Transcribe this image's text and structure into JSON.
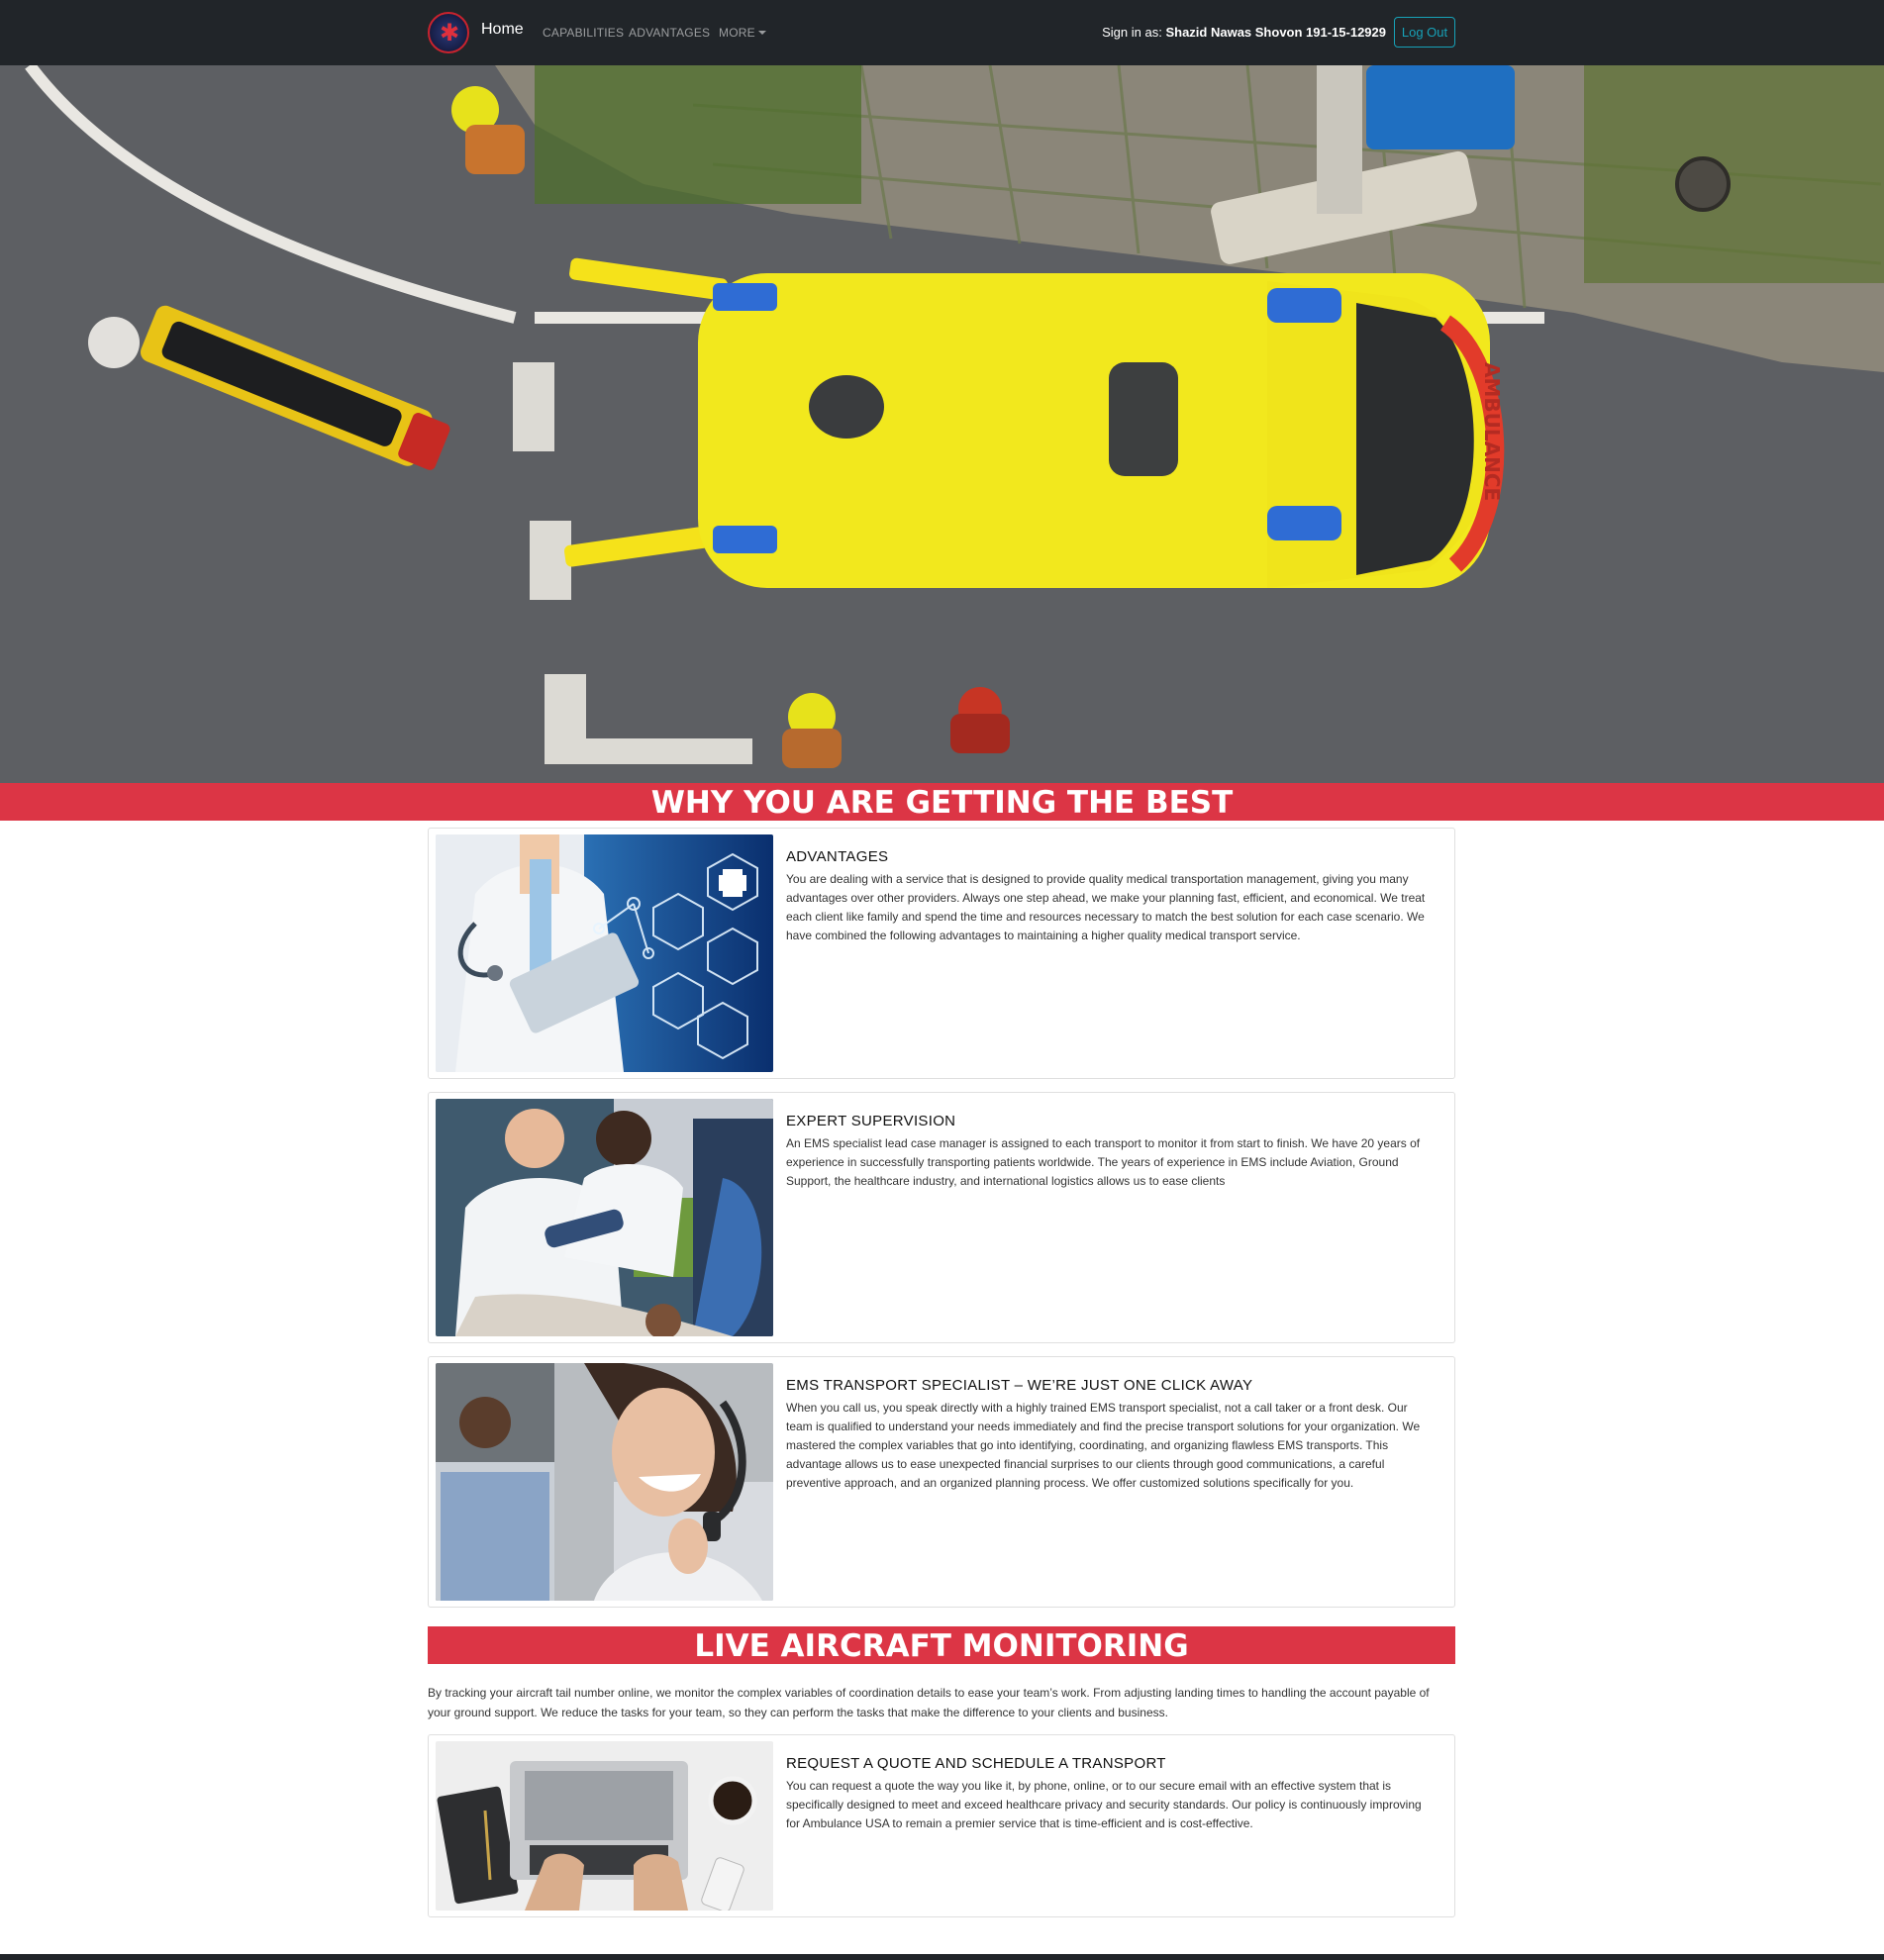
{
  "navbar": {
    "logo_icon": "star-of-life-logo",
    "home_label": "Home",
    "links": [
      "CAPABILITIES",
      "ADVANTAGES",
      "MORE"
    ],
    "signin_prefix": "Sign in as:",
    "user_name": "Shazid Nawas Shovon 191-15-12929",
    "logout_label": "Log Out"
  },
  "hero": {
    "image": "aerial-ambulance-photo",
    "vehicle_text": "AMBULANCE"
  },
  "why_banner": "WHY YOU ARE GETTING THE BEST",
  "cards": [
    {
      "image": "doctor-tablet-medical-icons-photo",
      "title": "ADVANTAGES",
      "text": "You are dealing with a service that is designed to provide quality medical transportation management, giving you many advantages over other providers. Always one step ahead, we make your planning fast, efficient, and economical. We treat each client like family and spend the time and resources necessary to match the best solution for each case scenario. We have combined the following advantages to maintaining a higher quality medical transport service."
    },
    {
      "image": "paramedics-patient-photo",
      "title": "EXPERT SUPERVISION",
      "text": "An EMS specialist lead case manager is assigned to each transport to monitor it from start to finish. We have 20 years of experience in successfully transporting patients worldwide. The years of experience in EMS include Aviation, Ground Support, the healthcare industry, and international logistics allows us to ease clients"
    },
    {
      "image": "call-center-agent-photo",
      "title": "EMS TRANSPORT SPECIALIST – WE’RE JUST ONE CLICK AWAY",
      "text": "When you call us, you speak directly with a highly trained EMS transport specialist, not a call taker or a front desk. Our team is qualified to understand your needs immediately and find the precise transport solutions for your organization. We mastered the complex variables that go into identifying, coordinating, and organizing flawless EMS transports. This advantage allows us to ease unexpected financial surprises to our clients through good communications, a careful preventive approach, and an organized planning process. We offer customized solutions specifically for you."
    }
  ],
  "monitoring": {
    "banner": "LIVE AIRCRAFT MONITORING",
    "paragraph": "By tracking your aircraft tail number online, we monitor the complex variables of coordination details to ease your team’s work. From adjusting landing times to handling the account payable of your ground support. We reduce the tasks for your team, so they can perform the tasks that make the difference to your clients and business."
  },
  "quote_card": {
    "image": "laptop-desk-photo",
    "title": "REQUEST A QUOTE AND SCHEDULE A TRANSPORT",
    "text": "You can request a quote the way you like it, by phone, online, or to our secure email with an effective system that is specifically designed to meet and exceed healthcare privacy and security standards. Our policy is continuously improving for Ambulance USA to remain a premier service that is time-efficient and is cost-effective."
  }
}
